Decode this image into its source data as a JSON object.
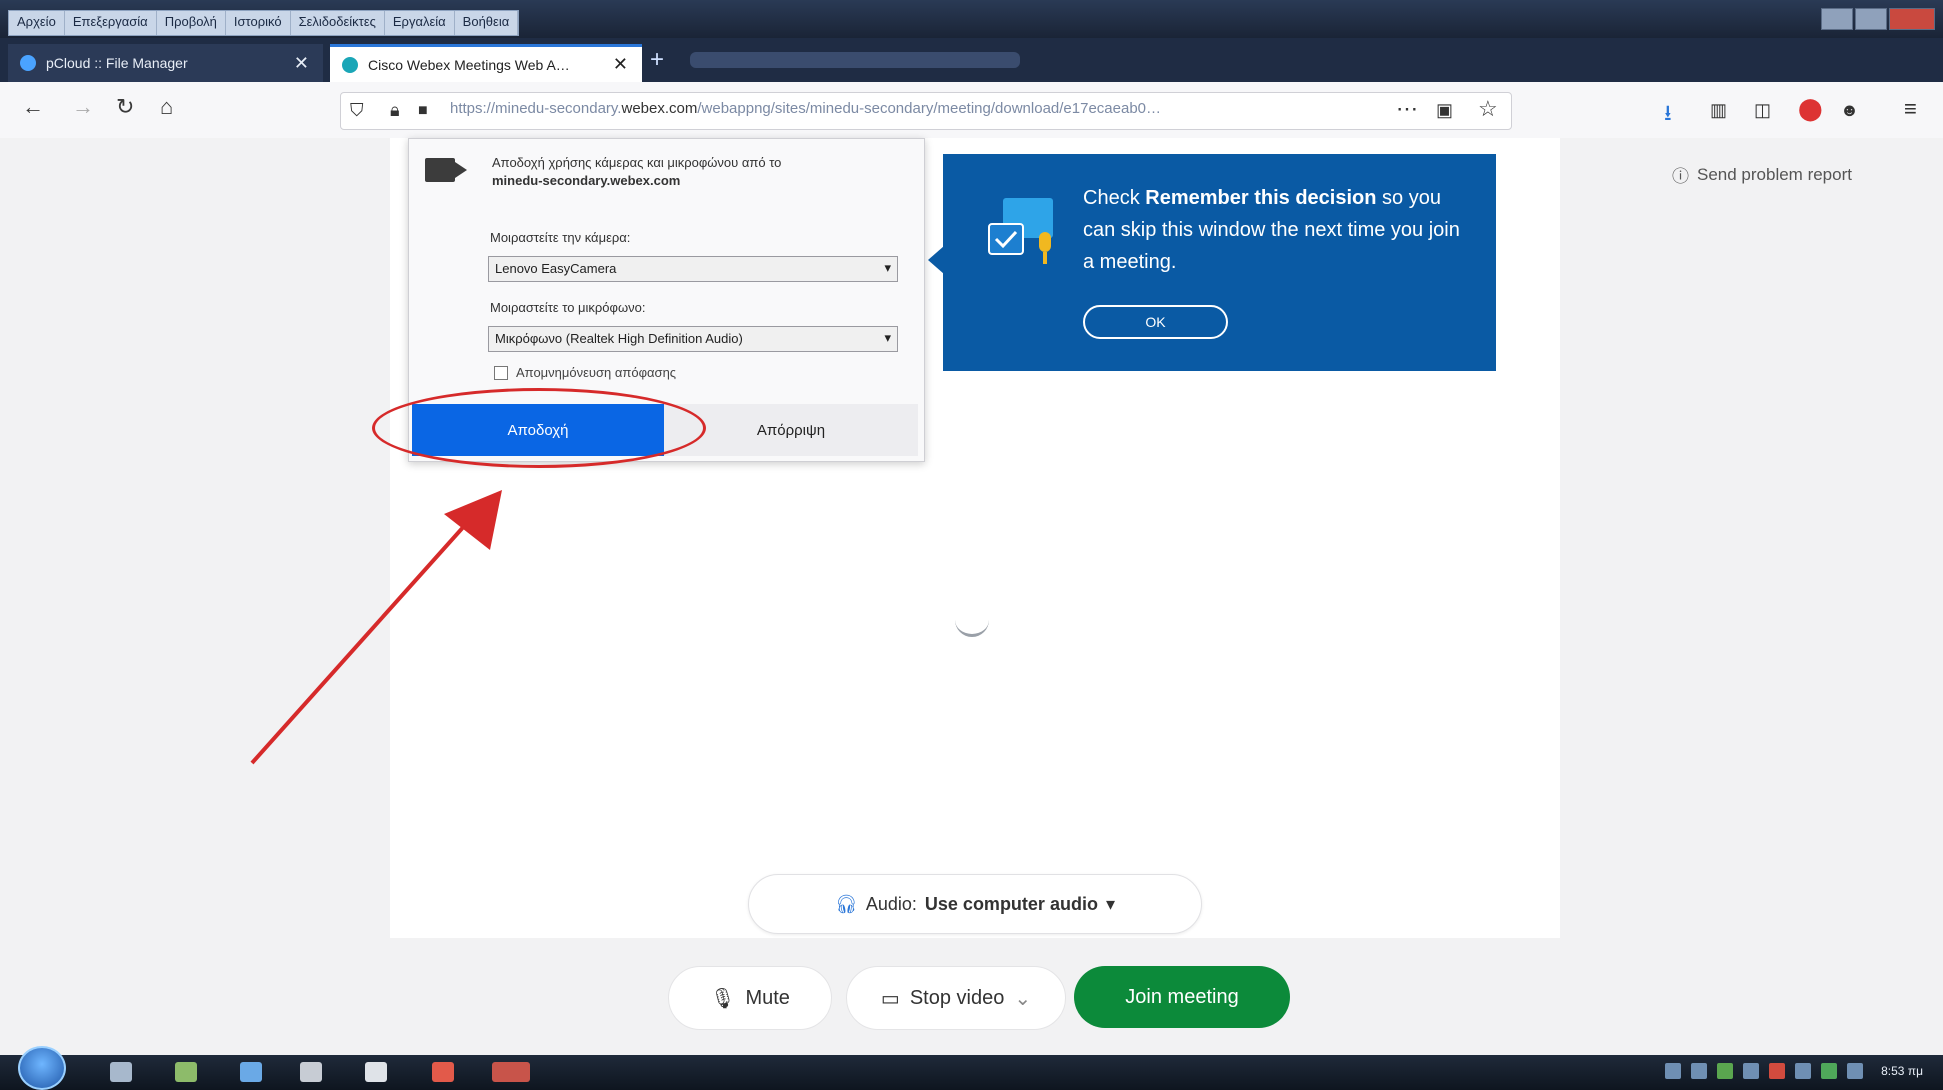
{
  "browser": {
    "menu": [
      "Αρχείο",
      "Επεξεργασία",
      "Προβολή",
      "Ιστορικό",
      "Σελιδοδείκτες",
      "Εργαλεία",
      "Βοήθεια"
    ],
    "tabs": [
      {
        "title": "pCloud :: File Manager",
        "favicon_color": "#4aa3ff"
      },
      {
        "title": "Cisco Webex Meetings Web A…",
        "favicon_color": "#1aa6b7"
      }
    ],
    "new_tab_symbol": "+",
    "url_prefix": "https://minedu-secondary.",
    "url_domain": "webex.com",
    "url_suffix": "/webappng/sites/minedu-secondary/meeting/download/e17ecaeab0…",
    "send_problem_report": "Send problem report"
  },
  "permission_popup": {
    "message": "Αποδοχή χρήσης κάμερας και μικροφώνου από το",
    "domain": "minedu-secondary.webex.com",
    "camera_label": "Μοιραστείτε την κάμερα:",
    "camera_value": "Lenovo EasyCamera",
    "mic_label": "Μοιραστείτε το μικρόφωνο:",
    "mic_value": "Μικρόφωνο (Realtek High Definition Audio)",
    "remember_label": "Απομνημόνευση απόφασης",
    "allow_label": "Αποδοχή",
    "deny_label": "Απόρριψη"
  },
  "callout": {
    "prefix": "Check",
    "bold": "Remember this decision",
    "suffix": "so you can skip this window the next time you join a meeting.",
    "ok_label": "OK"
  },
  "meeting": {
    "audio_label": "Audio:",
    "audio_value": "Use computer audio",
    "mute_label": "Mute",
    "video_label": "Stop video",
    "join_label": "Join meeting"
  },
  "taskbar": {
    "clock": "8:53 πμ"
  },
  "colors": {
    "allow_blue": "#0a66e4",
    "callout_blue": "#0a5aa4",
    "join_green": "#0c8a3a",
    "annotation_red": "#d62a2a"
  }
}
